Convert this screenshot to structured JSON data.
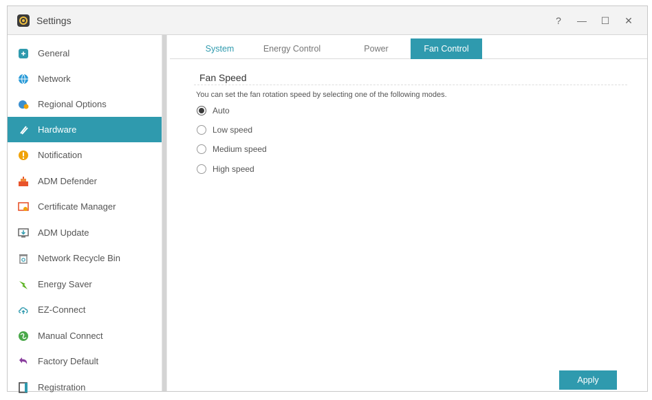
{
  "window": {
    "title": "Settings",
    "controls": {
      "help": "?",
      "minimize": "—",
      "maximize": "☐",
      "close": "✕"
    }
  },
  "sidebar": {
    "items": [
      {
        "label": "General",
        "icon": "general-icon",
        "color": "#2f9aae"
      },
      {
        "label": "Network",
        "icon": "globe-icon",
        "color": "#2b9bd8"
      },
      {
        "label": "Regional Options",
        "icon": "regional-icon",
        "color": "#3a8fcf"
      },
      {
        "label": "Hardware",
        "icon": "hardware-icon",
        "color": "#ffffff",
        "active": true
      },
      {
        "label": "Notification",
        "icon": "notification-icon",
        "color": "#f0a30a"
      },
      {
        "label": "ADM Defender",
        "icon": "defender-icon",
        "color": "#e8542c"
      },
      {
        "label": "Certificate Manager",
        "icon": "certificate-icon",
        "color": "#e8542c"
      },
      {
        "label": "ADM Update",
        "icon": "update-icon",
        "color": "#666666"
      },
      {
        "label": "Network Recycle Bin",
        "icon": "recycle-bin-icon",
        "color": "#888888"
      },
      {
        "label": "Energy Saver",
        "icon": "energy-saver-icon",
        "color": "#5ab21f"
      },
      {
        "label": "EZ-Connect",
        "icon": "cloud-upload-icon",
        "color": "#2f9aae"
      },
      {
        "label": "Manual Connect",
        "icon": "manual-connect-icon",
        "color": "#4aa84a"
      },
      {
        "label": "Factory Default",
        "icon": "undo-icon",
        "color": "#8a3f9e"
      },
      {
        "label": "Registration",
        "icon": "registration-icon",
        "color": "#444444"
      }
    ]
  },
  "tabs": [
    {
      "label": "System"
    },
    {
      "label": "Energy Control"
    },
    {
      "label": "Power"
    },
    {
      "label": "Fan Control",
      "active": true
    }
  ],
  "fan": {
    "title": "Fan Speed",
    "description": "You can set the fan rotation speed by selecting one of the following modes.",
    "options": [
      {
        "label": "Auto",
        "checked": true
      },
      {
        "label": "Low speed",
        "checked": false
      },
      {
        "label": "Medium speed",
        "checked": false
      },
      {
        "label": "High speed",
        "checked": false
      }
    ],
    "selected": "Auto"
  },
  "apply_label": "Apply",
  "colors": {
    "accent": "#2f9aae"
  }
}
